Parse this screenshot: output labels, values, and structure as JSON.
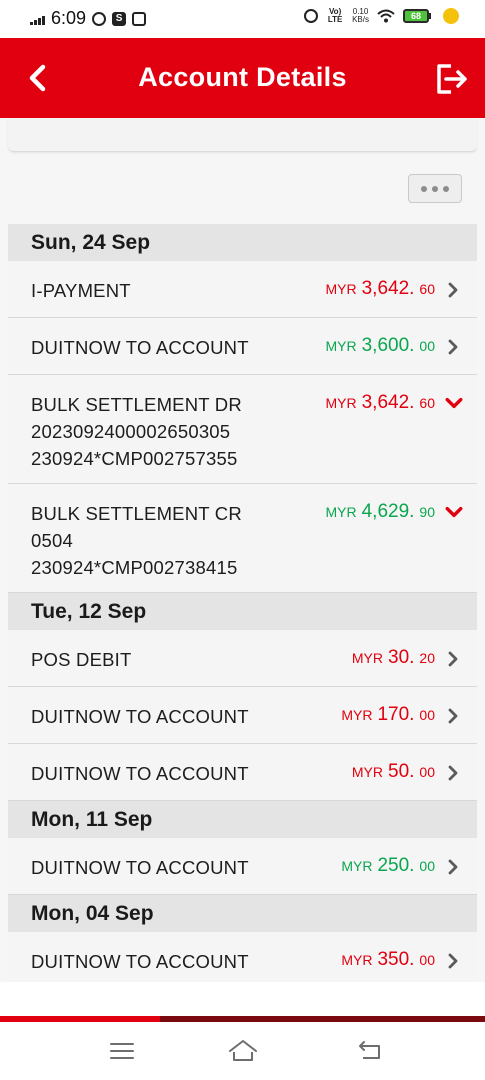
{
  "status_bar": {
    "time": "6:09",
    "volte": "Vo) LTE",
    "net_speed_value": "0.10",
    "net_speed_unit": "KB/s",
    "battery": "68"
  },
  "header": {
    "title": "Account Details",
    "back_icon": "chevron-left-icon",
    "logout_icon": "logout-icon",
    "color": "#e1000f"
  },
  "colors": {
    "debit": "#e1000f",
    "credit": "#0aa64f"
  },
  "groups": [
    {
      "date": "Sun, 24 Sep",
      "transactions": [
        {
          "lines": [
            "I-PAYMENT"
          ],
          "currency": "MYR",
          "amount": "3,642.",
          "cents": "60",
          "type": "debit",
          "chevron": "right"
        },
        {
          "lines": [
            "DUITNOW TO ACCOUNT"
          ],
          "currency": "MYR",
          "amount": "3,600.",
          "cents": "00",
          "type": "credit",
          "chevron": "right"
        },
        {
          "lines": [
            "BULK SETTLEMENT DR",
            "2023092400002650305",
            "230924*CMP002757355"
          ],
          "currency": "MYR",
          "amount": "3,642.",
          "cents": "60",
          "type": "debit",
          "chevron": "down"
        },
        {
          "lines": [
            "BULK SETTLEMENT CR",
            "0504",
            "230924*CMP002738415"
          ],
          "currency": "MYR",
          "amount": "4,629.",
          "cents": "90",
          "type": "credit",
          "chevron": "down"
        }
      ]
    },
    {
      "date": "Tue, 12 Sep",
      "transactions": [
        {
          "lines": [
            "POS DEBIT"
          ],
          "currency": "MYR",
          "amount": "30.",
          "cents": "20",
          "type": "debit",
          "chevron": "right"
        },
        {
          "lines": [
            "DUITNOW TO ACCOUNT"
          ],
          "currency": "MYR",
          "amount": "170.",
          "cents": "00",
          "type": "debit",
          "chevron": "right"
        },
        {
          "lines": [
            "DUITNOW TO ACCOUNT"
          ],
          "currency": "MYR",
          "amount": "50.",
          "cents": "00",
          "type": "debit",
          "chevron": "right"
        }
      ]
    },
    {
      "date": "Mon, 11 Sep",
      "transactions": [
        {
          "lines": [
            "DUITNOW TO ACCOUNT"
          ],
          "currency": "MYR",
          "amount": "250.",
          "cents": "00",
          "type": "credit",
          "chevron": "right"
        }
      ]
    },
    {
      "date": "Mon, 04 Sep",
      "transactions": [
        {
          "lines": [
            "DUITNOW TO ACCOUNT"
          ],
          "currency": "MYR",
          "amount": "350.",
          "cents": "00",
          "type": "debit",
          "chevron": "right"
        }
      ]
    }
  ],
  "nav_bar": {
    "icons": [
      "menu-icon",
      "home-icon",
      "back-icon"
    ]
  }
}
